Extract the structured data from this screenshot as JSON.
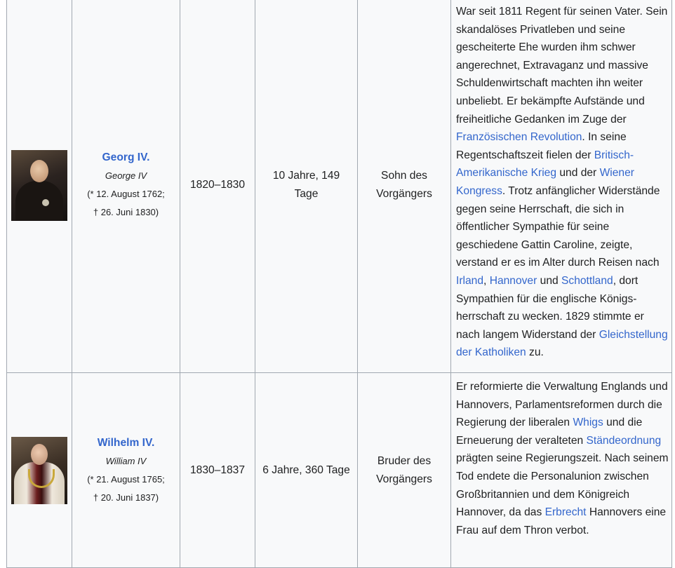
{
  "rows": [
    {
      "name": "Georg IV.",
      "original_name": "George IV",
      "birth": "(* 12. August 1762;",
      "death": "† 26. Juni 1830)",
      "reign": "1820–1830",
      "duration": "10 Jahre, 149 Tage",
      "relation": "Sohn des Vorgängers",
      "desc": [
        {
          "t": "War seit 1811 Regent für seinen Vater. Sein skandalöses Privatleben und seine gescheiterte Ehe wurden ihm schwer angerechnet, Extravaganz und massive Schuldenwirtschaft machten ihn weiter unbeliebt. Er bekämpfte Aufstände und freiheitliche Gedanken im Zuge der "
        },
        {
          "t": "Französischen Revolution",
          "link": true
        },
        {
          "t": ". In seine Regentschaftszeit fielen der "
        },
        {
          "t": "Britisch-Amerikanische Krieg",
          "link": true
        },
        {
          "t": " und der "
        },
        {
          "t": "Wiener Kongress",
          "link": true
        },
        {
          "t": ". Trotz anfänglicher Widerstände gegen seine Herrschaft, die sich in öffentlicher Sympathie für seine geschiedene Gattin Caroline, zeigte, verstand er es im Alter durch Reisen nach "
        },
        {
          "t": "Irland",
          "link": true
        },
        {
          "t": ", "
        },
        {
          "t": "Hannover",
          "link": true
        },
        {
          "t": " und "
        },
        {
          "t": "Schottland",
          "link": true
        },
        {
          "t": ", dort Sympathien für die englische Königs-herrschaft zu wecken. 1829 stimmte er nach langem Widerstand der "
        },
        {
          "t": "Gleichstellung der Katholiken",
          "link": true
        },
        {
          "t": " zu."
        }
      ]
    },
    {
      "name": "Wilhelm IV.",
      "original_name": "William IV",
      "birth": "(* 21. August 1765;",
      "death": "† 20. Juni 1837)",
      "reign": "1830–1837",
      "duration": "6 Jahre, 360 Tage",
      "relation": "Bruder des Vorgängers",
      "desc": [
        {
          "t": "Er reformierte die Verwaltung Englands und Hannovers, Parlamentsreformen durch die Regierung der liberalen "
        },
        {
          "t": "Whigs",
          "link": true
        },
        {
          "t": " und die Erneuerung der veralteten "
        },
        {
          "t": "Ständeordnung",
          "link": true
        },
        {
          "t": " prägten seine Regierungszeit. Nach seinem Tod endete die Personalunion zwischen Großbritannien und dem Königreich Hannover, da das "
        },
        {
          "t": "Erbrecht",
          "link": true
        },
        {
          "t": " Hannovers eine Frau auf dem Thron verbot."
        }
      ]
    }
  ]
}
